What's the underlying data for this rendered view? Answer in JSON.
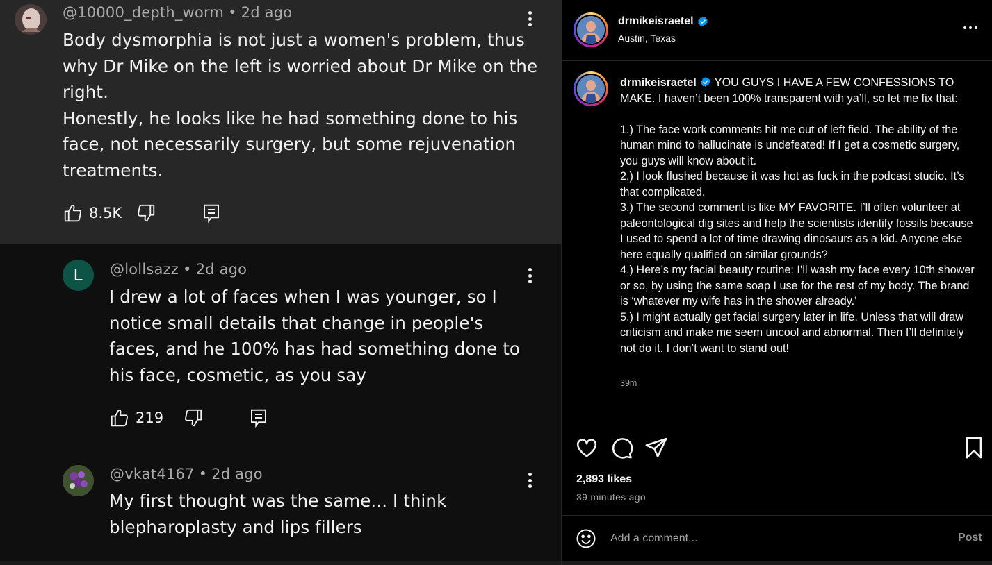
{
  "youtube": {
    "comments": [
      {
        "handle": "@10000_depth_worm",
        "age": "2d ago",
        "text": "Body dysmorphia is not just a women's problem, thus\nwhy Dr Mike on the left is worried about Dr Mike on the\nright.\nHonestly, he looks like he had something done to his\nface, not necessarily surgery, but some rejuvenation\ntreatments.",
        "likes": "8.5K"
      },
      {
        "handle": "@lollsazz",
        "age": "2d ago",
        "avatar_letter": "l",
        "avatar_color": "#0d5446",
        "text": "I drew a lot of faces when I was younger, so I\nnotice small details that change in people's\nfaces, and he 100% has had something done to\nhis face, cosmetic, as you say",
        "likes": "219"
      },
      {
        "handle": "@vkat4167",
        "age": "2d ago",
        "text": "My first thought was the same... I think\nblepharoplasty and lips fillers"
      }
    ]
  },
  "instagram": {
    "username": "drmikeisraetel",
    "location": "Austin, Texas",
    "caption": {
      "username": "drmikeisraetel",
      "text": "YOU GUYS I HAVE A FEW CONFESSIONS TO MAKE. I haven’t been 100% transparent with ya’ll, so let me fix that:\n\n1.) The face work comments hit me out of left field. The ability of the human mind to hallucinate is undefeated! If I get a cosmetic surgery, you guys will know about it.\n2.) I look flushed because it was hot as fuck in the podcast studio. It’s that complicated.\n3.) The second comment is like MY FAVORITE. I’ll often volunteer at paleontological dig sites and help the scientists identify fossils because I used to spend a lot of time drawing dinosaurs as a kid. Anyone else here equally qualified on similar grounds?\n4.) Here’s my facial beauty routine: I’ll wash my face every 10th shower or so, by using the same soap I use for the rest of my body. The brand is ‘whatever my wife has in the shower already.’\n5.) I might actually get facial surgery later in life. Unless that will draw criticism and make me seem uncool and abnormal. Then I’ll definitely not do it. I don’t want to stand out!",
      "time": "39m"
    },
    "likes": "2,893 likes",
    "posted": "39 minutes ago",
    "comment_placeholder": "Add a comment...",
    "post_label": "Post",
    "colors": {
      "verified": "#0095f6",
      "muted": "#a8a8a8",
      "border": "#262626"
    }
  }
}
